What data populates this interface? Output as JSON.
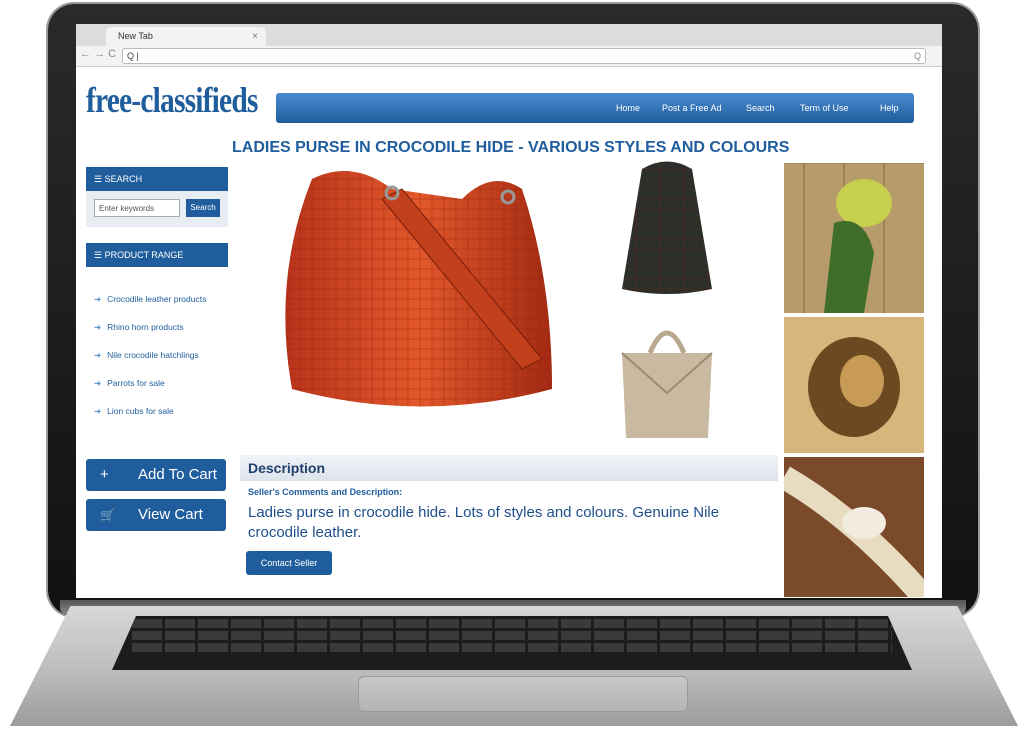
{
  "browser": {
    "tab_title": "New Tab",
    "tab_close": "×",
    "nav": "← → C",
    "url": "Q |",
    "url_icon": "Q"
  },
  "site": {
    "logo": "free-classifieds",
    "nav": [
      "Home",
      "Post a Free Ad",
      "Search",
      "Term of Use",
      "Help"
    ]
  },
  "listing": {
    "title": "LADIES PURSE IN CROCODILE HIDE - VARIOUS STYLES AND COLOURS"
  },
  "sidebar": {
    "search_heading": "☰ SEARCH",
    "search_placeholder": "Enter keywords",
    "search_button": "Search",
    "range_heading": "☰ PRODUCT RANGE",
    "items": [
      "Crocodile leather products",
      "Rhino horn products",
      "Nile crocodile hatchlings",
      "Parrots for sale",
      "Lion cubs for sale"
    ]
  },
  "cart": {
    "add_icon": "+",
    "add_label": "Add To Cart",
    "view_icon": "🛒",
    "view_label": "View Cart"
  },
  "description": {
    "heading": "Description",
    "subheading": "Seller's Comments and Description:",
    "text": "Ladies purse in crocodile hide. Lots of styles and colours. Genuine Nile crocodile leather.",
    "contact_button": "Contact Seller"
  },
  "icons": {
    "bullet": "➔"
  },
  "colors": {
    "brand_blue": "#1f5d9c",
    "bag_orange": "#d9481f"
  }
}
